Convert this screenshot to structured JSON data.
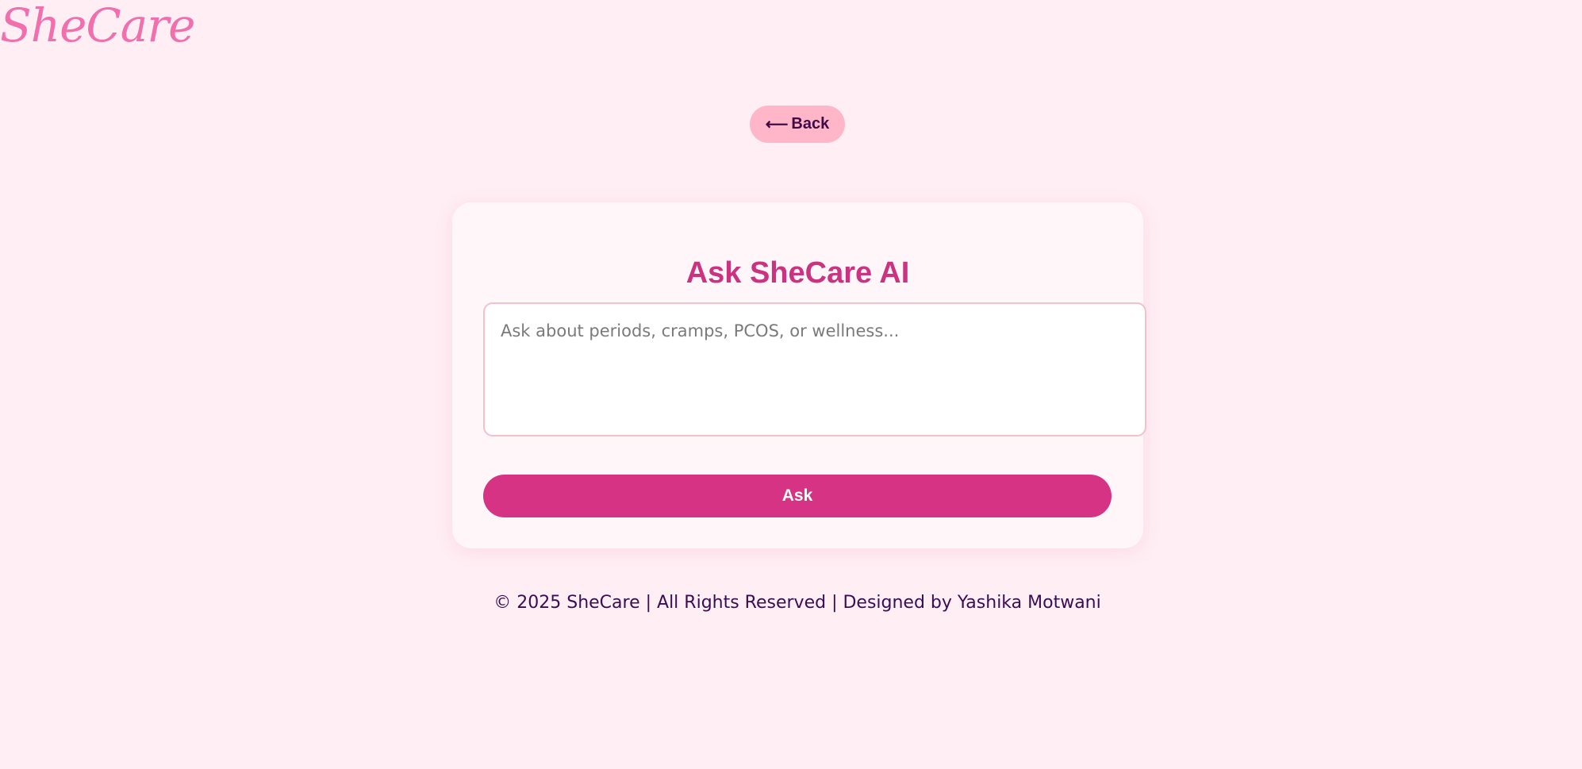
{
  "brand": {
    "logo_text": "SheCare"
  },
  "nav": {
    "back_arrow": "⟵",
    "back_label": "Back"
  },
  "card": {
    "title": "Ask SheCare AI",
    "input_placeholder": "Ask about periods, cramps, PCOS, or wellness...",
    "input_value": "",
    "ask_label": "Ask"
  },
  "footer": {
    "text": "© 2025 SheCare | All Rights Reserved | Designed by Yashika Motwani"
  },
  "colors": {
    "background": "#ffeef4",
    "logo": "#f26fad",
    "title": "#cb3380",
    "accent": "#d63384",
    "back_button": "#ffb6c8",
    "text_dark": "#3a0d52"
  }
}
